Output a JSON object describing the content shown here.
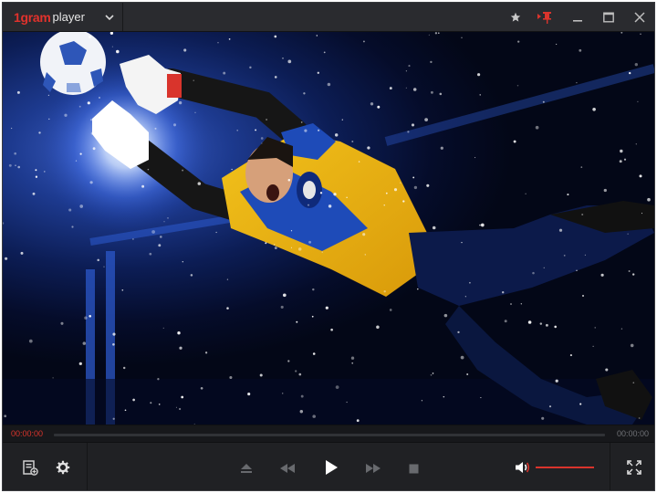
{
  "app": {
    "logo": "1gram",
    "name": "player"
  },
  "icons": {
    "menu": "chevron-down-icon",
    "favorite": "star-icon",
    "pin": "pin-icon",
    "minimize": "minimize-icon",
    "maximize": "maximize-icon",
    "close": "close-icon",
    "playlist": "playlist-icon",
    "settings": "gear-icon",
    "eject": "eject-icon",
    "rewind": "rewind-icon",
    "play": "play-icon",
    "forward": "fast-forward-icon",
    "stop": "stop-icon",
    "volume": "speaker-icon",
    "fullscreen": "fullscreen-icon"
  },
  "playback": {
    "current_time": "00:00:00",
    "total_time": "00:00:00",
    "progress": 0,
    "volume": 1
  },
  "colors": {
    "accent": "#d9342c",
    "background": "#1c1d20",
    "titlebar": "#2a2b2f",
    "controls": "#202124"
  }
}
